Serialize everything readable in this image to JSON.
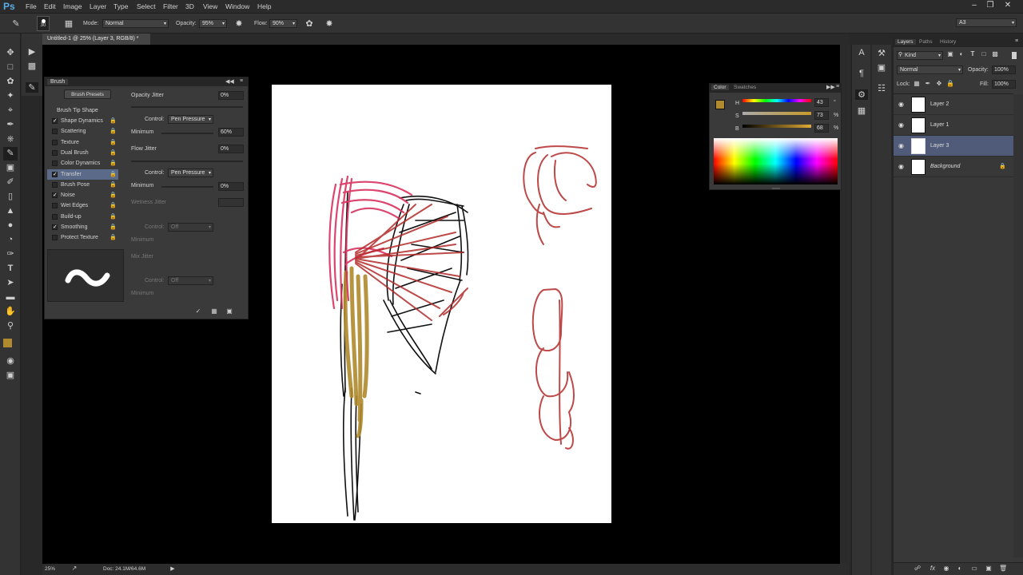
{
  "app_logo": "Ps",
  "menu": [
    "File",
    "Edit",
    "Image",
    "Layer",
    "Type",
    "Select",
    "Filter",
    "3D",
    "View",
    "Window",
    "Help"
  ],
  "options": {
    "brush_size": "30",
    "mode_label": "Mode:",
    "mode_value": "Normal",
    "opacity_label": "Opacity:",
    "opacity_value": "95%",
    "flow_label": "Flow:",
    "flow_value": "90%",
    "workspace": "A3"
  },
  "document": {
    "tab_title": "Untitled-1 @ 25% (Layer 3, RGB/8) *",
    "zoom": "25%",
    "doc_info": "Doc: 24.1M/64.6M"
  },
  "brush_panel": {
    "title": "Brush",
    "presets_button": "Brush Presets",
    "section_header": "Brush Tip Shape",
    "options": [
      {
        "label": "Shape Dynamics",
        "checked": true
      },
      {
        "label": "Scattering",
        "checked": false
      },
      {
        "label": "Texture",
        "checked": false
      },
      {
        "label": "Dual Brush",
        "checked": false
      },
      {
        "label": "Color Dynamics",
        "checked": false
      },
      {
        "label": "Transfer",
        "checked": true
      },
      {
        "label": "Brush Pose",
        "checked": false
      },
      {
        "label": "Noise",
        "checked": true
      },
      {
        "label": "Wet Edges",
        "checked": false
      },
      {
        "label": "Build-up",
        "checked": false
      },
      {
        "label": "Smoothing",
        "checked": true
      },
      {
        "label": "Protect Texture",
        "checked": false
      }
    ],
    "opacity_jitter_label": "Opacity Jitter",
    "opacity_jitter_value": "0%",
    "control_label": "Control:",
    "control_value": "Pen Pressure",
    "minimum_label": "Minimum",
    "opacity_minimum_value": "60%",
    "flow_jitter_label": "Flow Jitter",
    "flow_jitter_value": "0%",
    "flow_control_value": "Pen Pressure",
    "flow_minimum_value": "0%",
    "wetness_jitter_label": "Wetness Jitter",
    "wetness_control_value": "Off",
    "mix_jitter_label": "Mix Jitter",
    "mix_control_value": "Off"
  },
  "color_panel": {
    "tab_color": "Color",
    "tab_swatches": "Swatches",
    "h_label": "H",
    "h_value": "43",
    "h_unit": "°",
    "s_label": "S",
    "s_value": "73",
    "s_unit": "%",
    "b_label": "B",
    "b_value": "68",
    "b_unit": "%",
    "foreground_color": "#b08a2e",
    "background_color": "#ffffff"
  },
  "layers_panel": {
    "tabs": [
      "Layers",
      "Paths",
      "History"
    ],
    "filter_label": "Kind",
    "blend_mode": "Normal",
    "opacity_label": "Opacity:",
    "opacity_value": "100%",
    "lock_label": "Lock:",
    "fill_label": "Fill:",
    "fill_value": "100%",
    "layers": [
      {
        "name": "Layer 2",
        "selected": false
      },
      {
        "name": "Layer 1",
        "selected": false
      },
      {
        "name": "Layer 3",
        "selected": true
      },
      {
        "name": "Background",
        "selected": false
      }
    ]
  }
}
